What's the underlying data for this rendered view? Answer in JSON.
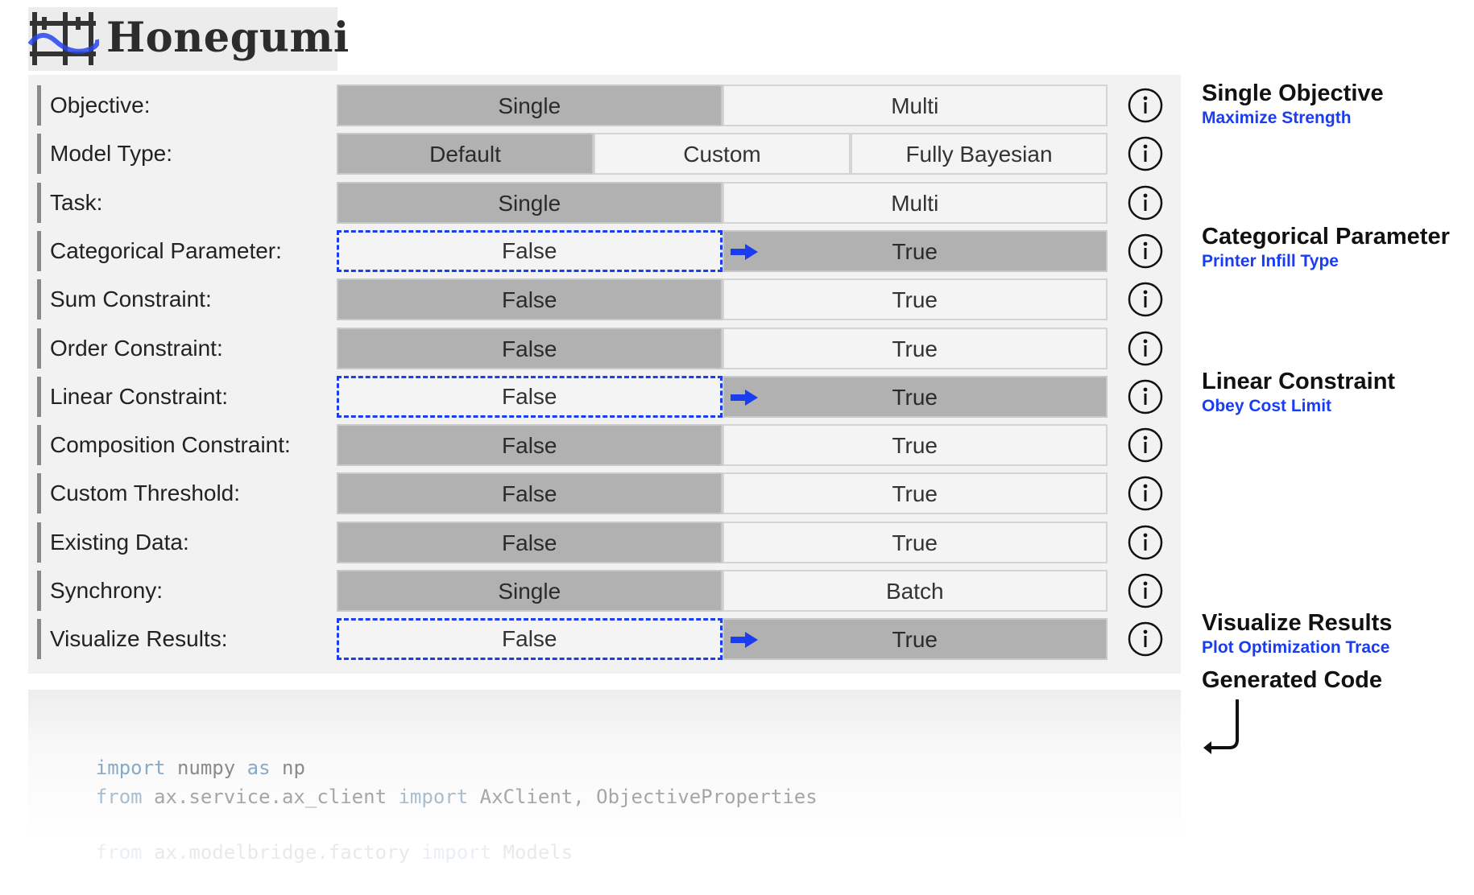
{
  "app": {
    "name": "Honegumi"
  },
  "rows": [
    {
      "label": "Objective:",
      "options": [
        {
          "text": "Single",
          "state": "selected"
        },
        {
          "text": "Multi",
          "state": "unselected"
        }
      ]
    },
    {
      "label": "Model Type:",
      "options": [
        {
          "text": "Default",
          "state": "selected"
        },
        {
          "text": "Custom",
          "state": "unselected"
        },
        {
          "text": "Fully Bayesian",
          "state": "unselected"
        }
      ]
    },
    {
      "label": "Task:",
      "options": [
        {
          "text": "Single",
          "state": "selected"
        },
        {
          "text": "Multi",
          "state": "unselected"
        }
      ]
    },
    {
      "label": "Categorical Parameter:",
      "options": [
        {
          "text": "False",
          "state": "highlighted"
        },
        {
          "text": "True",
          "state": "selected",
          "arrow": true
        }
      ]
    },
    {
      "label": "Sum Constraint:",
      "options": [
        {
          "text": "False",
          "state": "selected"
        },
        {
          "text": "True",
          "state": "unselected"
        }
      ]
    },
    {
      "label": "Order Constraint:",
      "options": [
        {
          "text": "False",
          "state": "selected"
        },
        {
          "text": "True",
          "state": "unselected"
        }
      ]
    },
    {
      "label": "Linear Constraint:",
      "options": [
        {
          "text": "False",
          "state": "highlighted"
        },
        {
          "text": "True",
          "state": "selected",
          "arrow": true
        }
      ]
    },
    {
      "label": "Composition Constraint:",
      "options": [
        {
          "text": "False",
          "state": "selected"
        },
        {
          "text": "True",
          "state": "unselected"
        }
      ]
    },
    {
      "label": "Custom Threshold:",
      "options": [
        {
          "text": "False",
          "state": "selected"
        },
        {
          "text": "True",
          "state": "unselected"
        }
      ]
    },
    {
      "label": "Existing Data:",
      "options": [
        {
          "text": "False",
          "state": "selected"
        },
        {
          "text": "True",
          "state": "unselected"
        }
      ]
    },
    {
      "label": "Synchrony:",
      "options": [
        {
          "text": "Single",
          "state": "selected"
        },
        {
          "text": "Batch",
          "state": "unselected"
        }
      ]
    },
    {
      "label": "Visualize Results:",
      "options": [
        {
          "text": "False",
          "state": "highlighted"
        },
        {
          "text": "True",
          "state": "selected",
          "arrow": true
        }
      ]
    }
  ],
  "code": {
    "line1": {
      "kw1": "import",
      "mod": " numpy ",
      "kw2": "as",
      "alias": " np"
    },
    "line2": {
      "kw1": "from",
      "mod": " ax.service.ax_client ",
      "kw2": "import",
      "names": " AxClient, ObjectiveProperties"
    },
    "line3": {
      "kw1": "from",
      "mod": " ax.modelbridge.factory ",
      "kw2": "import",
      "names": " Models"
    }
  },
  "annotations": {
    "single_objective": {
      "title": "Single Objective",
      "sub": "Maximize Strength"
    },
    "categorical": {
      "title": "Categorical Parameter",
      "sub": "Printer Infill Type"
    },
    "linear": {
      "title": "Linear Constraint",
      "sub": "Obey Cost Limit"
    },
    "visualize": {
      "title": "Visualize Results",
      "sub": "Plot Optimization Trace"
    },
    "generated_code": {
      "title": "Generated Code"
    }
  },
  "colors": {
    "selected": "#b1b1b1",
    "highlight": "#1a3df0",
    "panel": "#f2f2f2"
  }
}
